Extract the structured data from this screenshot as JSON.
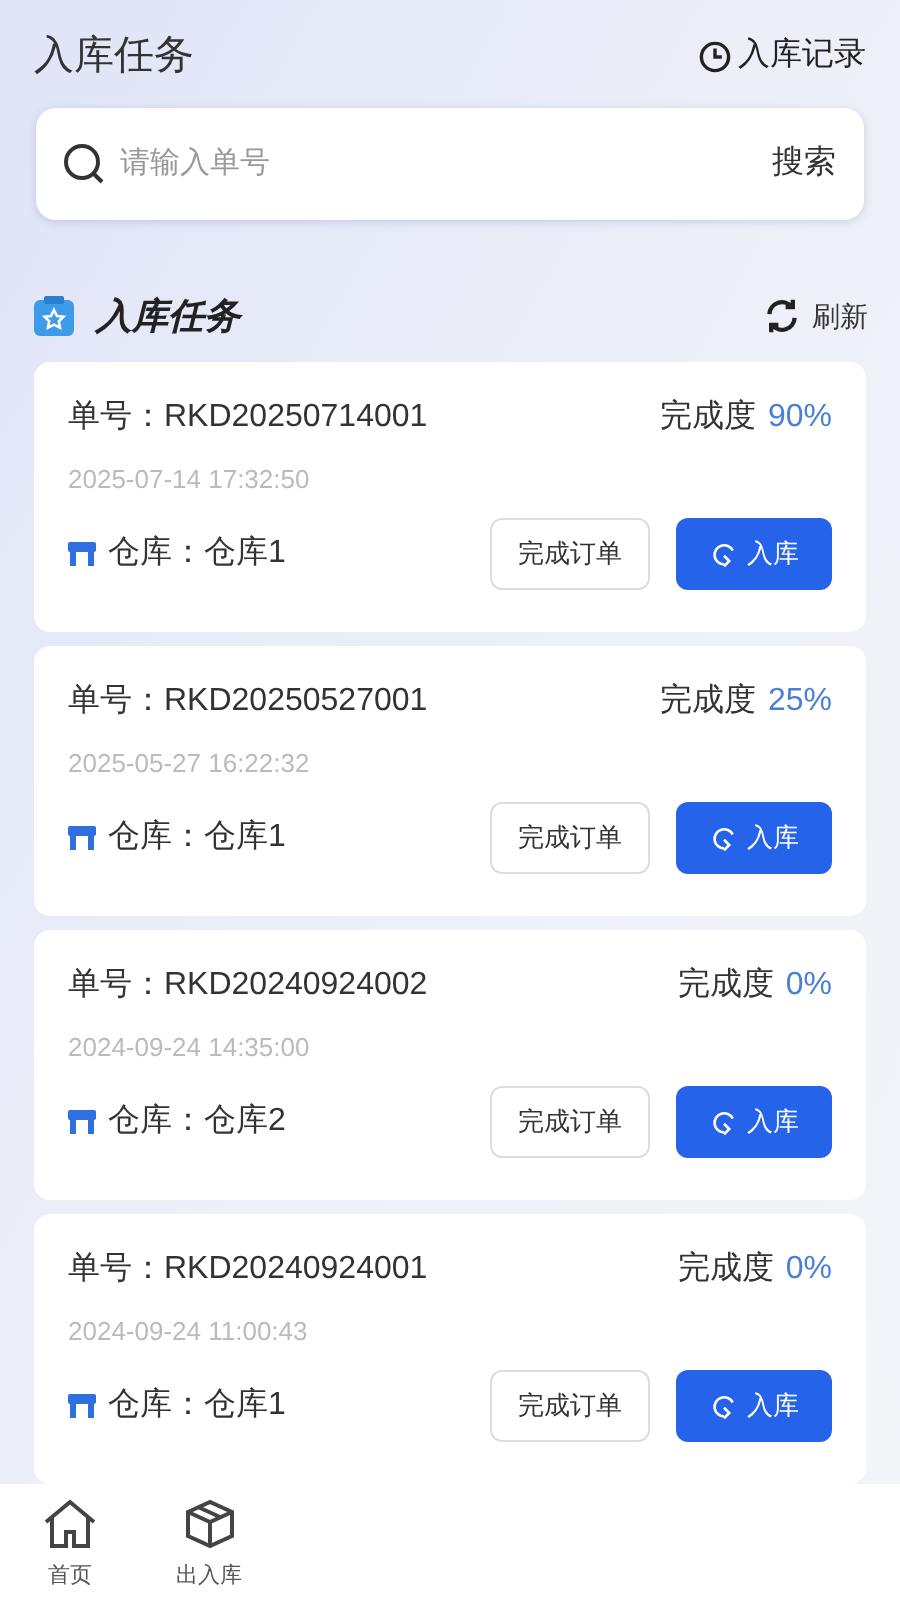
{
  "header": {
    "title": "入库任务",
    "record_link": "入库记录"
  },
  "search": {
    "placeholder": "请输入单号",
    "button": "搜索"
  },
  "section": {
    "title": "入库任务",
    "refresh": "刷新"
  },
  "tasks": [
    {
      "order": "单号：RKD20250714001",
      "progress_label": "完成度",
      "progress": "90%",
      "time": "2025-07-14 17:32:50",
      "warehouse": "仓库：仓库1",
      "complete_button": "完成订单",
      "inbound_button": "入库"
    },
    {
      "order": "单号：RKD20250527001",
      "progress_label": "完成度",
      "progress": "25%",
      "time": "2025-05-27 16:22:32",
      "warehouse": "仓库：仓库1",
      "complete_button": "完成订单",
      "inbound_button": "入库"
    },
    {
      "order": "单号：RKD20240924002",
      "progress_label": "完成度",
      "progress": "0%",
      "time": "2024-09-24 14:35:00",
      "warehouse": "仓库：仓库2",
      "complete_button": "完成订单",
      "inbound_button": "入库"
    },
    {
      "order": "单号：RKD20240924001",
      "progress_label": "完成度",
      "progress": "0%",
      "time": "2024-09-24 11:00:43",
      "warehouse": "仓库：仓库1",
      "complete_button": "完成订单",
      "inbound_button": "入库"
    }
  ],
  "tab_bar": [
    {
      "label": "首页",
      "kind": "home"
    },
    {
      "label": "出入库",
      "kind": "box"
    }
  ]
}
